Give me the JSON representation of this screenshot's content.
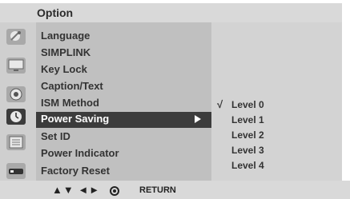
{
  "header": {
    "title": "Option"
  },
  "menu": {
    "items": [
      {
        "label": "Language",
        "icon": "satellite-dish-icon"
      },
      {
        "label": "SIMPLINK",
        "icon": "monitor-icon"
      },
      {
        "label": "Key Lock",
        "icon": "monitor-icon"
      },
      {
        "label": "Caption/Text",
        "icon": "speaker-icon"
      },
      {
        "label": "ISM Method",
        "icon": "speaker-icon"
      },
      {
        "label": "Power Saving",
        "icon": "clock-icon",
        "selected": true
      },
      {
        "label": "Set ID",
        "icon": "option-icon"
      },
      {
        "label": "Power Indicator",
        "icon": "option-icon"
      },
      {
        "label": "Factory Reset",
        "icon": "input-source-icon"
      }
    ]
  },
  "submenu": {
    "check_mark": "√",
    "items": [
      {
        "label": "Level 0",
        "checked": true
      },
      {
        "label": "Level 1",
        "checked": false
      },
      {
        "label": "Level 2",
        "checked": false
      },
      {
        "label": "Level 3",
        "checked": false
      },
      {
        "label": "Level 4",
        "checked": false
      }
    ]
  },
  "footer": {
    "nav_symbols": "▲▼ ◄►",
    "return_label": "RETURN"
  },
  "colors": {
    "selected_row": "#3c3c3c",
    "menu_bg": "#c0c0c0",
    "submenu_bg": "#d3d3d3",
    "bar_bg": "#d9d9d9"
  }
}
